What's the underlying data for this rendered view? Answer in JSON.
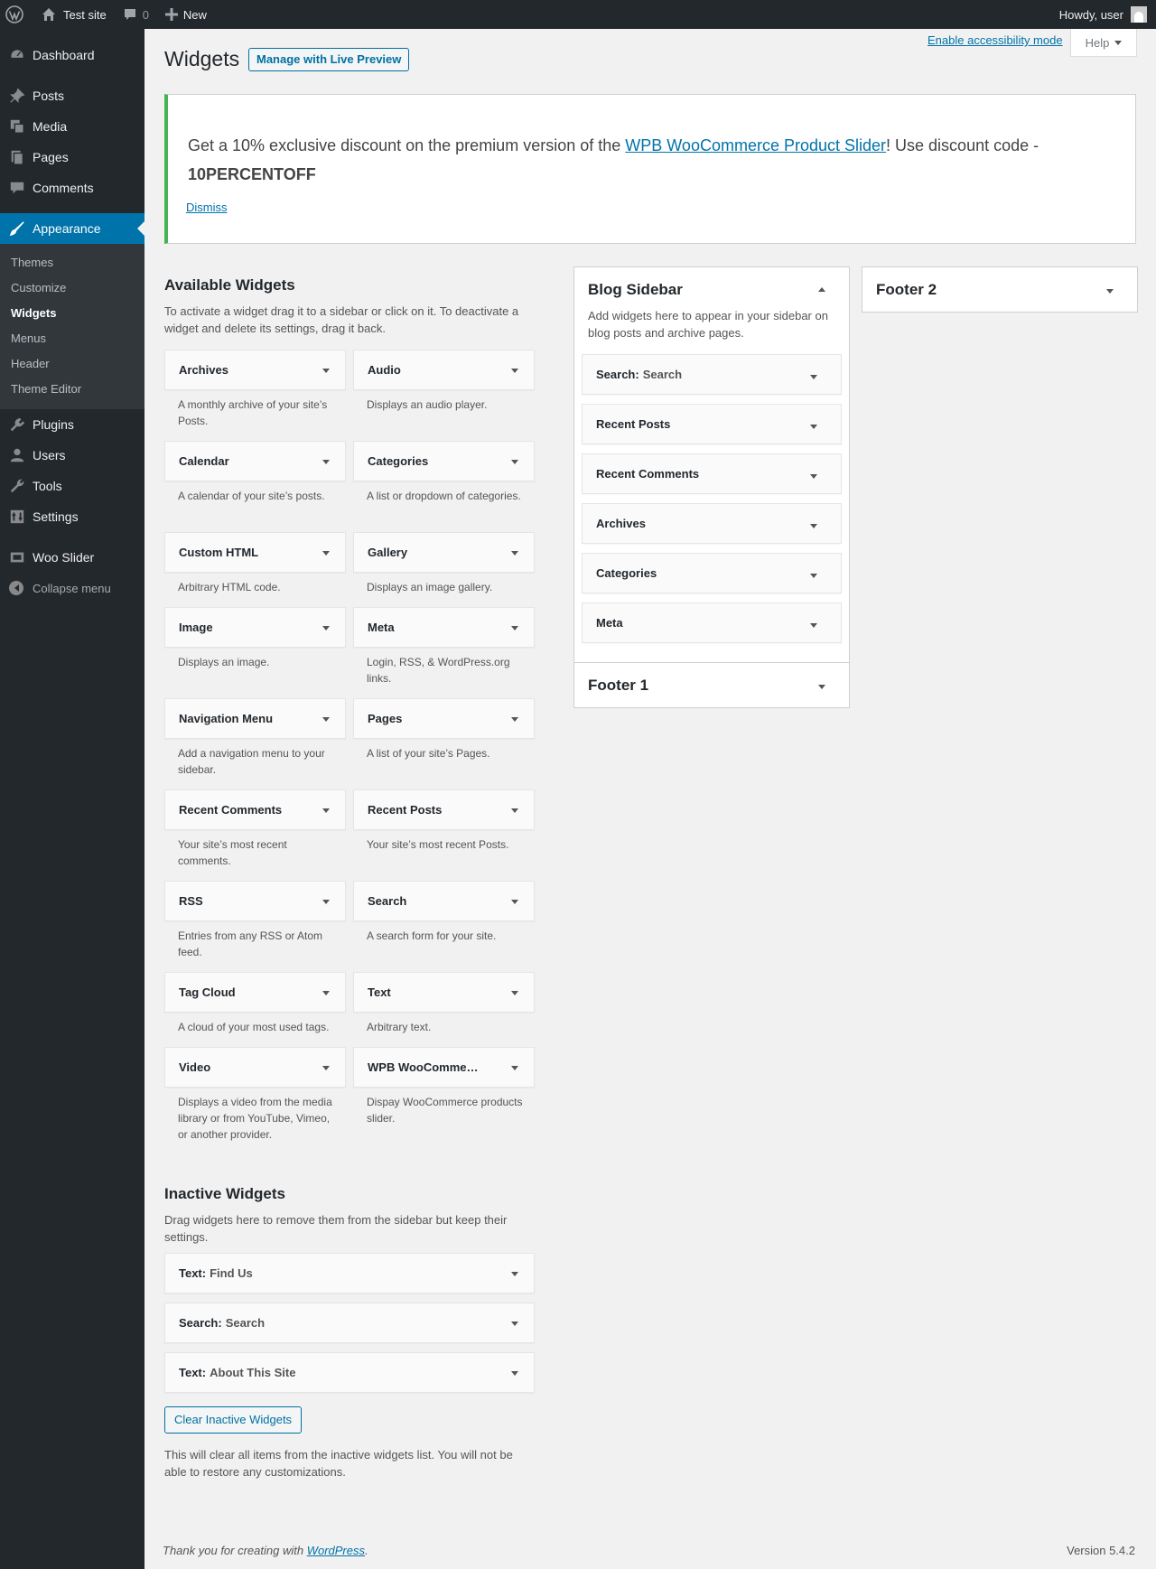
{
  "adminbar": {
    "site_name": "Test site",
    "comments_count": "0",
    "new_label": "New",
    "howdy": "Howdy, user"
  },
  "menu": {
    "dashboard": "Dashboard",
    "posts": "Posts",
    "media": "Media",
    "pages": "Pages",
    "comments": "Comments",
    "appearance": "Appearance",
    "appearance_sub": [
      "Themes",
      "Customize",
      "Widgets",
      "Menus",
      "Header",
      "Theme Editor"
    ],
    "plugins": "Plugins",
    "users": "Users",
    "tools": "Tools",
    "settings": "Settings",
    "woo_slider": "Woo Slider",
    "collapse": "Collapse menu"
  },
  "header": {
    "title": "Widgets",
    "preview_button": "Manage with Live Preview",
    "accessibility": "Enable accessibility mode",
    "help": "Help"
  },
  "notice": {
    "text_before": "Get a 10% exclusive discount on the premium version of the ",
    "link": "WPB WooCommerce Product Slider",
    "text_after": "! Use discount code - ",
    "code": "10PERCENTOFF",
    "dismiss": "Dismiss"
  },
  "available": {
    "title": "Available Widgets",
    "description": "To activate a widget drag it to a sidebar or click on it. To deactivate a widget and delete its settings, drag it back.",
    "widgets": [
      {
        "name": "Archives",
        "desc": "A monthly archive of your site’s Posts."
      },
      {
        "name": "Audio",
        "desc": "Displays an audio player."
      },
      {
        "name": "Calendar",
        "desc": "A calendar of your site’s posts."
      },
      {
        "name": "Categories",
        "desc": "A list or dropdown of categories."
      },
      {
        "name": "Custom HTML",
        "desc": "Arbitrary HTML code."
      },
      {
        "name": "Gallery",
        "desc": "Displays an image gallery."
      },
      {
        "name": "Image",
        "desc": "Displays an image."
      },
      {
        "name": "Meta",
        "desc": "Login, RSS, & WordPress.org links."
      },
      {
        "name": "Navigation Menu",
        "desc": "Add a navigation menu to your sidebar."
      },
      {
        "name": "Pages",
        "desc": "A list of your site’s Pages."
      },
      {
        "name": "Recent Comments",
        "desc": "Your site’s most recent comments."
      },
      {
        "name": "Recent Posts",
        "desc": "Your site’s most recent Posts."
      },
      {
        "name": "RSS",
        "desc": "Entries from any RSS or Atom feed."
      },
      {
        "name": "Search",
        "desc": "A search form for your site."
      },
      {
        "name": "Tag Cloud",
        "desc": "A cloud of your most used tags."
      },
      {
        "name": "Text",
        "desc": "Arbitrary text."
      },
      {
        "name": "Video",
        "desc": "Displays a video from the media library or from YouTube, Vimeo, or another provider."
      },
      {
        "name": "WPB WooComme…",
        "desc": "Dispay WooCommerce products slider."
      }
    ]
  },
  "blog_sidebar": {
    "title": "Blog Sidebar",
    "description": "Add widgets here to appear in your sidebar on blog posts and archive pages.",
    "widgets": [
      {
        "name": "Search:",
        "instance": "Search"
      },
      {
        "name": "Recent Posts",
        "instance": ""
      },
      {
        "name": "Recent Comments",
        "instance": ""
      },
      {
        "name": "Archives",
        "instance": ""
      },
      {
        "name": "Categories",
        "instance": ""
      },
      {
        "name": "Meta",
        "instance": ""
      }
    ]
  },
  "footer1": {
    "title": "Footer 1"
  },
  "footer2": {
    "title": "Footer 2"
  },
  "inactive": {
    "title": "Inactive Widgets",
    "description": "Drag widgets here to remove them from the sidebar but keep their settings.",
    "widgets": [
      {
        "name": "Text:",
        "instance": "Find Us"
      },
      {
        "name": "Search:",
        "instance": "Search"
      },
      {
        "name": "Text:",
        "instance": "About This Site"
      }
    ],
    "clear_button": "Clear Inactive Widgets",
    "clear_note": "This will clear all items from the inactive widgets list. You will not be able to restore any customizations."
  },
  "footer": {
    "thanks_before": "Thank you for creating with ",
    "thanks_link": "WordPress",
    "thanks_after": ".",
    "version": "Version 5.4.2"
  }
}
